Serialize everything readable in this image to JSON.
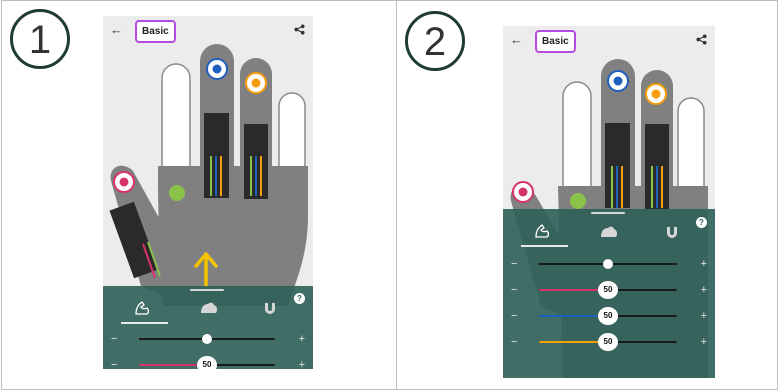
{
  "steps": [
    {
      "number": "1"
    },
    {
      "number": "2"
    }
  ],
  "app": {
    "mode_label": "Basic",
    "back_glyph": "←",
    "help_label": "?",
    "tabs": [
      {
        "icon": "flexed-arm-icon",
        "selected": true
      },
      {
        "icon": "palm-icon",
        "selected": false
      },
      {
        "icon": "magnet-icon",
        "selected": false
      }
    ]
  },
  "sliders": [
    {
      "name": "overall",
      "value": 50,
      "color": "#1a1a1a",
      "show_value": false
    },
    {
      "name": "thumb",
      "value": 50,
      "color": "#d6336c",
      "show_value": true
    },
    {
      "name": "index",
      "value": 50,
      "color": "#1f5fbf",
      "show_value": true
    },
    {
      "name": "middle",
      "value": 50,
      "color": "#f59e0b",
      "show_value": true
    }
  ],
  "colors": {
    "accent_badge": "#b34de0",
    "thumb_sensor": "#d6336c",
    "index_sensor": "#1f5fbf",
    "middle_sensor": "#f59e0b",
    "palm_dot": "#8bc34a",
    "arrow": "#f5c400",
    "sheet": "#2f5f59"
  },
  "slider_text": {
    "minus": "−",
    "plus": "+"
  }
}
